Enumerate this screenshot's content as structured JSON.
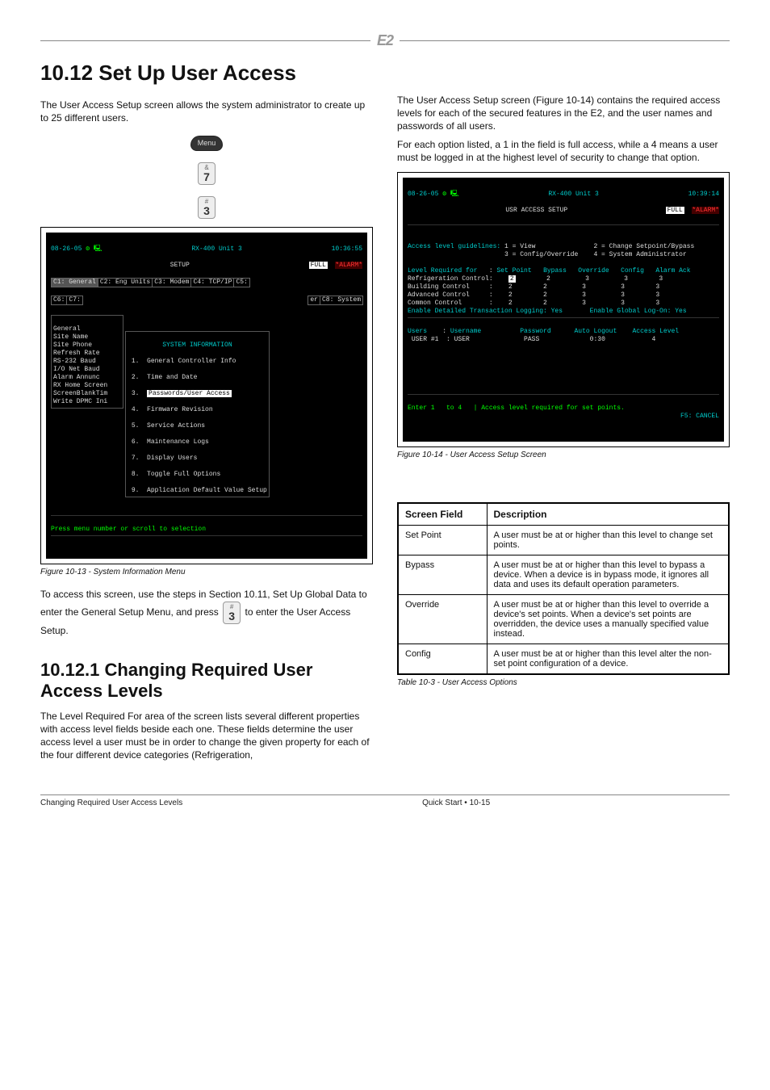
{
  "header": {
    "logo": "E2"
  },
  "section_title": "10.12 Set Up User Access",
  "intro_left": "The User Access Setup screen allows the system administrator to create up to 25 different users.",
  "keys": {
    "menu": "Menu",
    "amp": "&",
    "seven": "7",
    "hash": "#",
    "three": "3",
    "plus": "+"
  },
  "intro_right_1": "The User Access Setup screen (Figure 10-14) contains the required access levels for each of the secured features in the E2, and the user names and passwords of all users.",
  "intro_right_2": "For each option listed, a 1 in the field is full access, while a 4 means a user must be logged in at the highest level of security to change that option.",
  "screenshot_setup": {
    "date": "08-26-05",
    "device": "RX-400 Unit 3",
    "screen": "SETUP",
    "mode": "FULL",
    "time": "10:36:55",
    "alarm": "*ALARM*",
    "tabs": [
      "C1: General",
      "C2: Eng Units",
      "C3: Modem",
      "C4: TCP/IP",
      "C5:",
      "C6:",
      "C7:",
      "C8: System"
    ],
    "panel_title": "SYSTEM INFORMATION",
    "side_items": [
      "General",
      "Site Name",
      "Site Phone",
      "Refresh Rate",
      "RS-232 Baud",
      "I/O Net Baud",
      "Alarm Annunc",
      "RX Home Screen",
      "ScreenBlankTim",
      "Write DPMC Ini"
    ],
    "menu_items": [
      {
        "n": "1.",
        "t": "General Controller Info"
      },
      {
        "n": "2.",
        "t": "Time and Date"
      },
      {
        "n": "3.",
        "t": "Passwords/User Access",
        "hl": true
      },
      {
        "n": "4.",
        "t": "Firmware Revision"
      },
      {
        "n": "5.",
        "t": "Service Actions"
      },
      {
        "n": "6.",
        "t": "Maintenance Logs"
      },
      {
        "n": "7.",
        "t": "Display Users"
      },
      {
        "n": "8.",
        "t": "Toggle Full Options"
      },
      {
        "n": "9.",
        "t": "Application Default Value Setup"
      }
    ],
    "statusbar": "Press menu number or scroll to selection",
    "caption": "Figure 10-13 - System Information Menu"
  },
  "screenshot_access": {
    "date": "08-26-05",
    "device": "RX-400 Unit 3",
    "screen": "USR ACCESS SETUP",
    "mode": "FULL",
    "time": "10:39:14",
    "alarm": "*ALARM*",
    "guidelines_label": "Access level guidelines:",
    "guide": [
      "1 = View",
      "2 = Change Setpoint/Bypass",
      "3 = Config/Override",
      "4 = System Administrator"
    ],
    "cols": [
      "Level Required for",
      "Set Point",
      "Bypass",
      "Override",
      "Config",
      "Alarm Ack"
    ],
    "rows": [
      {
        "name": "Refrigeration Control:",
        "v": [
          "2",
          "2",
          "3",
          "3",
          "3"
        ]
      },
      {
        "name": "Building Control     :",
        "v": [
          "2",
          "2",
          "3",
          "3",
          "3"
        ]
      },
      {
        "name": "Advanced Control     :",
        "v": [
          "2",
          "2",
          "3",
          "3",
          "3"
        ]
      },
      {
        "name": "Common Control       :",
        "v": [
          "2",
          "2",
          "3",
          "3",
          "3"
        ]
      }
    ],
    "logging": "Enable Detailed Transaction Logging: Yes",
    "global": "Enable Global Log-On: Yes",
    "usercols": [
      "Users",
      "Username",
      "Password",
      "Auto Logout",
      "Access Level"
    ],
    "userrow": {
      "id": "USER #1",
      "user": "USER",
      "pass": "PASS",
      "logout": "0:30",
      "lvl": "4"
    },
    "statusbar": "Enter 1   to 4   | Access level required for set points.",
    "f5": "F5: CANCEL",
    "caption": "Figure 10-14 - User Access Setup Screen"
  },
  "after_figs": "To access this screen, use the steps in Section 10.11, Set Up Global Data to enter the General Setup Menu, and press ",
  "after_figs_tail": " to enter the User Access Setup.",
  "subsection_title": "10.12.1 Changing Required User Access Levels",
  "subsection_body": "The Level Required For area of the screen lists several different properties with access level fields beside each one. These fields determine the user access level a user must be in order to change the given property for each of the four different device categories (Refrigeration,",
  "fields_table": {
    "head_field": "Screen Field",
    "head_desc": "Description",
    "rows": [
      {
        "name": "Set Point",
        "desc": "A user must be at or higher than this level to change set points."
      },
      {
        "name": "Bypass",
        "desc": "A user must be at or higher than this level to bypass a device. When a device is in bypass mode, it ignores all data and uses its default operation parameters."
      },
      {
        "name": "Override",
        "desc": "A user must be at or higher than this level to override a device's set points. When a device's set points are overridden, the device uses a manually specified value instead."
      },
      {
        "name": "Config",
        "desc": "A user must be at or higher than this level alter the non-set point configuration of a device."
      }
    ],
    "caption": "Table 10-3 - User Access Options"
  },
  "footer": {
    "left": "Changing Required User Access Levels",
    "center": "Quick Start • 10-15",
    "page": ""
  }
}
